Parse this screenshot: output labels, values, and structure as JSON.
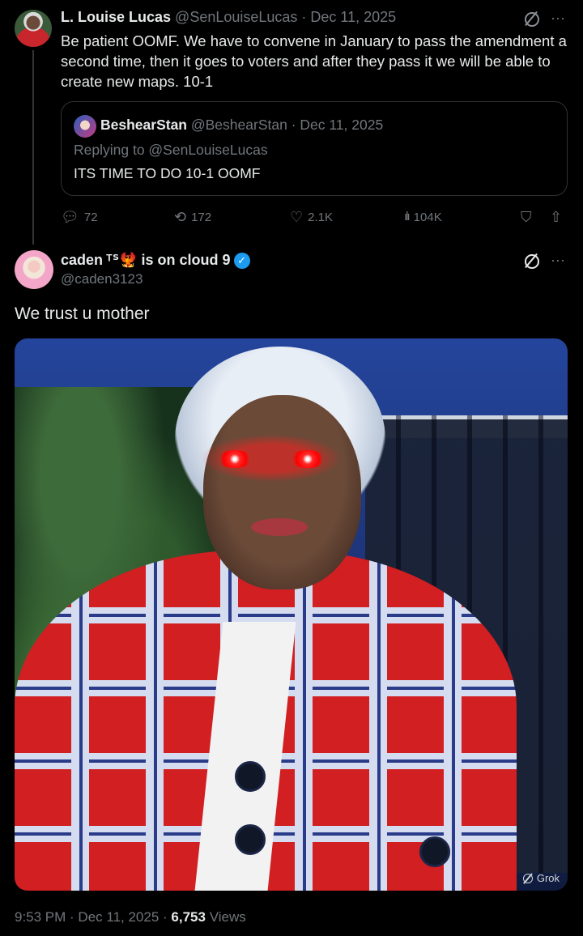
{
  "parent_tweet": {
    "display_name": "L. Louise Lucas",
    "handle": "@SenLouiseLucas",
    "date": "Dec 11, 2025",
    "text": "Be patient OOMF.  We have to convene in January to pass the amendment a second time, then it goes to voters and after they pass it we will be able to create new maps.  10-1",
    "quoted": {
      "display_name": "BeshearStan",
      "handle": "@BeshearStan",
      "date": "Dec 11, 2025",
      "replying_to": "Replying to @SenLouiseLucas",
      "text": "ITS TIME TO DO 10-1 OOMF"
    },
    "metrics": {
      "replies": "72",
      "reposts": "172",
      "likes": "2.1K",
      "views": "104K"
    }
  },
  "main_tweet": {
    "display_name": "caden",
    "name_suffix": "ᵀᔆ🐦‍🔥 is on cloud 9",
    "handle": "@caden3123",
    "text": "We trust u mother",
    "media_watermark": "Grok",
    "time": "9:53 PM",
    "date": "Dec 11, 2025",
    "views_count": "6,753",
    "views_label": "Views"
  },
  "icons": {
    "grok": "grok-icon",
    "more": "more-icon",
    "reply": "reply-icon",
    "repost": "repost-icon",
    "like": "heart-icon",
    "views": "views-icon",
    "bookmark": "bookmark-icon",
    "share": "share-icon",
    "verified": "verified-badge-icon"
  },
  "colors": {
    "background": "#000000",
    "text_primary": "#e7e9ea",
    "text_secondary": "#71767b",
    "verified": "#1d9bf0",
    "border": "#2f3336"
  }
}
